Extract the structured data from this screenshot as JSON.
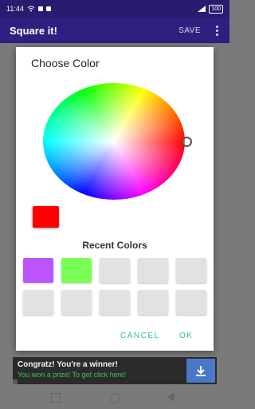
{
  "status_bar": {
    "time": "11:44",
    "battery": "100"
  },
  "app_bar": {
    "title": "Square it!",
    "save_label": "SAVE"
  },
  "dialog": {
    "title": "Choose Color",
    "selected_color": "#ff0000",
    "recent_label": "Recent Colors",
    "recent_colors": [
      "#bb55ff",
      "#77ff55",
      "#e2e2e2",
      "#e2e2e2",
      "#e2e2e2",
      "#e2e2e2",
      "#e2e2e2",
      "#e2e2e2",
      "#e2e2e2",
      "#e2e2e2"
    ],
    "cancel_label": "CANCEL",
    "ok_label": "OK"
  },
  "ad": {
    "title": "Congratz! You're a winner!",
    "subtitle": "You won a prize! To get click here!"
  },
  "icons": {
    "status": [
      "wifi-icon",
      "signal-icon",
      "battery-icon"
    ],
    "app": [
      "more-vert-icon"
    ],
    "ad": [
      "download-icon"
    ]
  }
}
